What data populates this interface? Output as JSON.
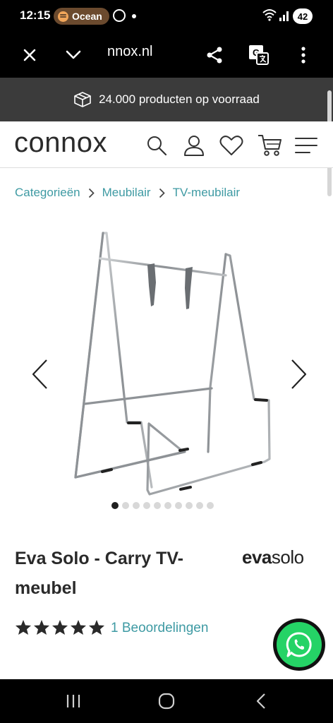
{
  "status_bar": {
    "time": "12:15",
    "spotify_pill": "Ocean",
    "battery": "42"
  },
  "browser": {
    "url": "nnox.nl"
  },
  "banner": {
    "text": "24.000 producten op voorraad"
  },
  "header": {
    "logo": "connox"
  },
  "breadcrumb": {
    "items": [
      "Categorieën",
      "Meubilair",
      "TV-meubilair"
    ]
  },
  "gallery": {
    "dot_count": 10,
    "active_index": 0
  },
  "product": {
    "title": "Eva Solo - Carry TV-meubel",
    "brand_part1": "eva",
    "brand_part2": "solo",
    "rating": 5,
    "reviews_label": "1 Beoordelingen"
  },
  "colors": {
    "accent": "#3e9aa3",
    "banner_bg": "#3b3b3b",
    "whatsapp": "#25d366"
  }
}
